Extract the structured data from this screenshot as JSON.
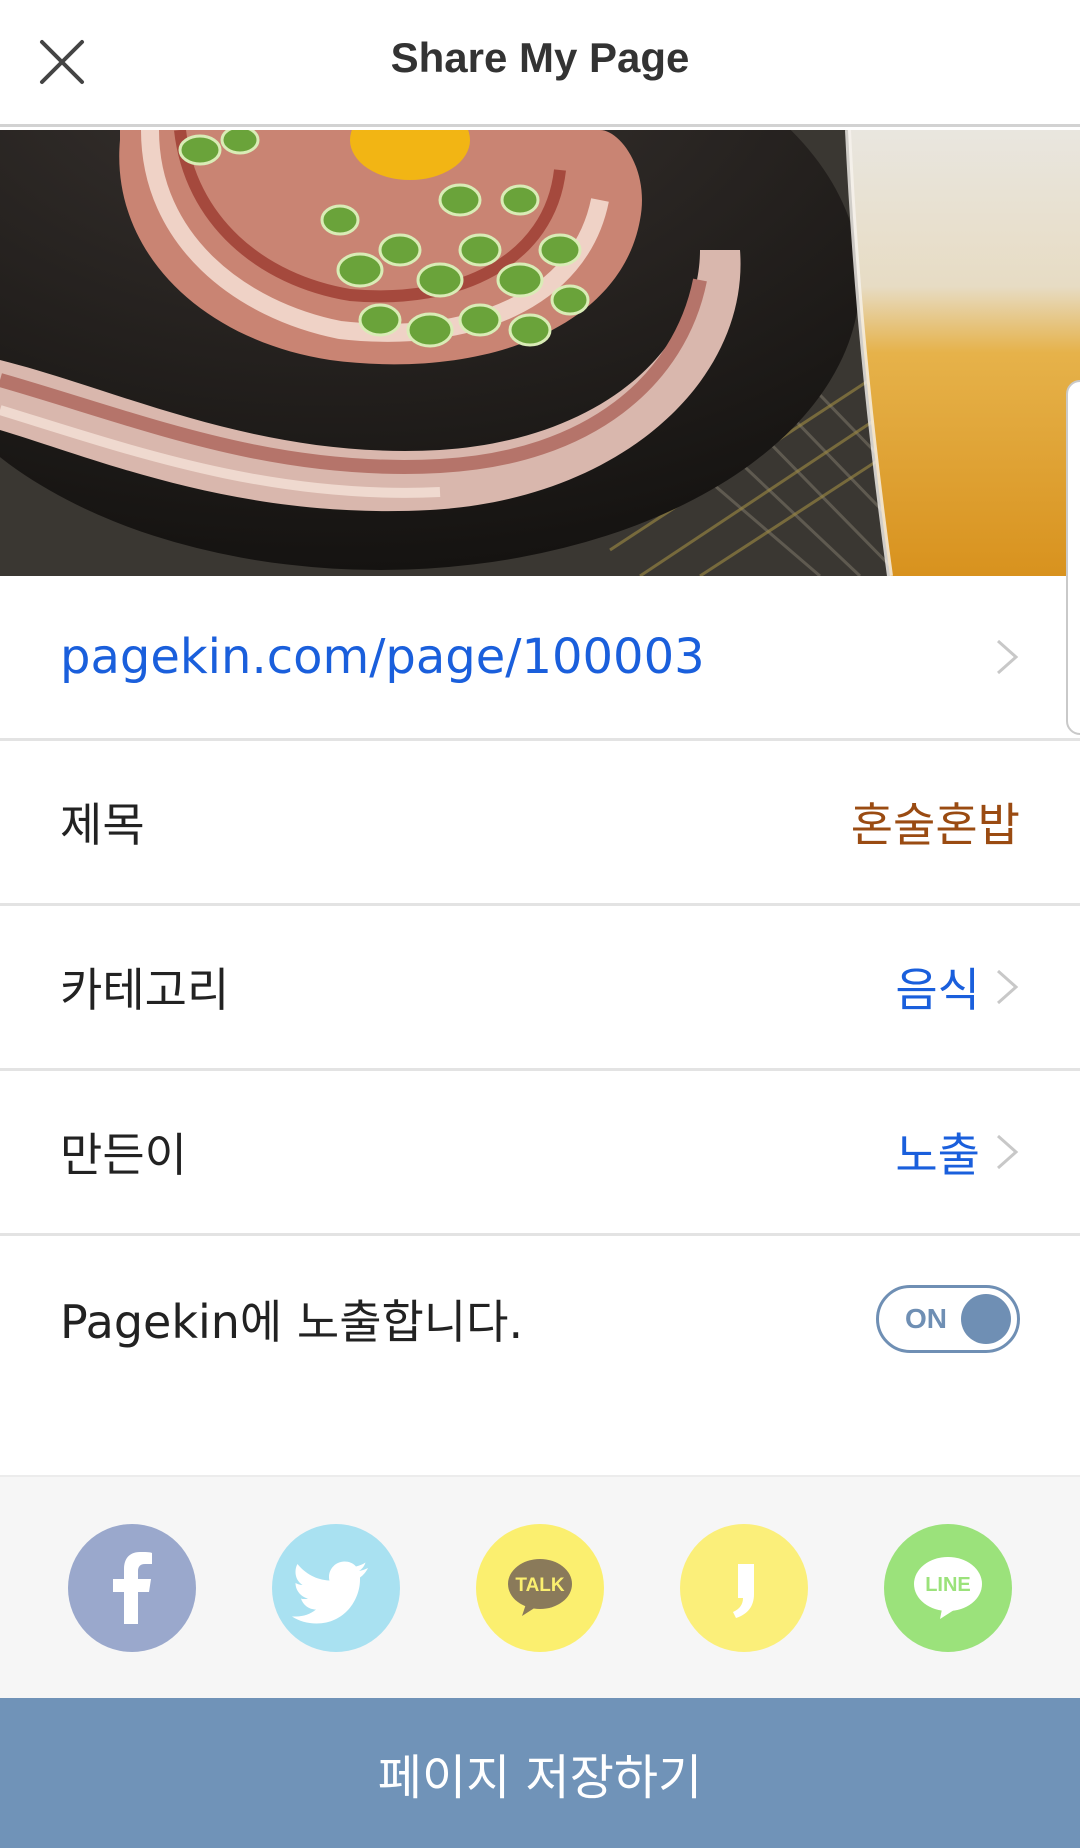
{
  "header": {
    "title": "Share My Page",
    "close_icon": "close-icon"
  },
  "hero": {
    "description_icon": "food-photo"
  },
  "url_row": {
    "url": "pagekin.com/page/100003"
  },
  "title_row": {
    "label": "제목",
    "value": "혼술혼밥",
    "value_color": "#9a4b12"
  },
  "category_row": {
    "label": "카테고리",
    "value": "음식",
    "value_color": "#1a5fdc"
  },
  "creator_row": {
    "label": "만든이",
    "value": "노출",
    "value_color": "#1a5fdc"
  },
  "expose_row": {
    "label": "Pagekin에 노출합니다.",
    "toggle_label": "ON",
    "toggle_on": true
  },
  "share": {
    "buttons": [
      {
        "name": "facebook",
        "color": "#9aa8cc",
        "icon": "facebook-icon"
      },
      {
        "name": "twitter",
        "color": "#a9e1f1",
        "icon": "twitter-icon"
      },
      {
        "name": "kakaotalk",
        "color": "#fbef6f",
        "icon": "kakaotalk-icon",
        "text": "TALK"
      },
      {
        "name": "kakaostory",
        "color": "#fbef7a",
        "icon": "kakaostory-icon"
      },
      {
        "name": "line",
        "color": "#9be27b",
        "icon": "line-icon",
        "text": "LINE"
      }
    ]
  },
  "footer": {
    "save_label": "페이지 저장하기",
    "save_color": "#7093b8"
  }
}
